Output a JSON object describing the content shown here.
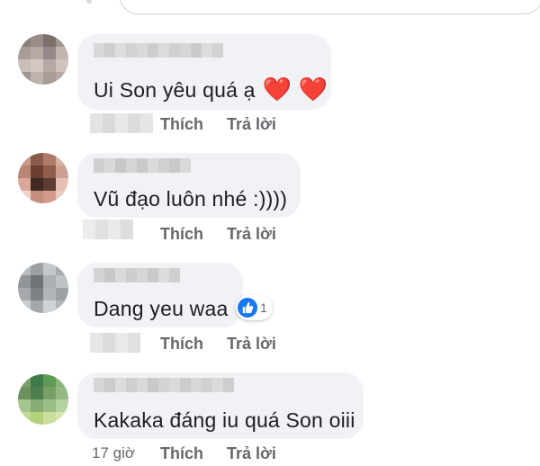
{
  "actions": {
    "like": "Thích",
    "reply": "Trả lời"
  },
  "comments": [
    {
      "text": "Ui Son yêu quá ạ",
      "hearts": "❤️ ❤️",
      "time": ""
    },
    {
      "text": "Vũ đạo luôn nhé :))))",
      "time": ""
    },
    {
      "text": "Dang yeu waa",
      "reaction_count": "1",
      "time": ""
    },
    {
      "text": "Kakaka đáng iu quá Son oiii",
      "time": "17 giờ"
    }
  ],
  "colors": {
    "bubble": "#f0f2f5",
    "meta": "#65676b",
    "like_blue": "#1877f2",
    "heart": "#e0245e"
  },
  "icons": [
    "thumbs-up-icon",
    "heart-icon"
  ]
}
